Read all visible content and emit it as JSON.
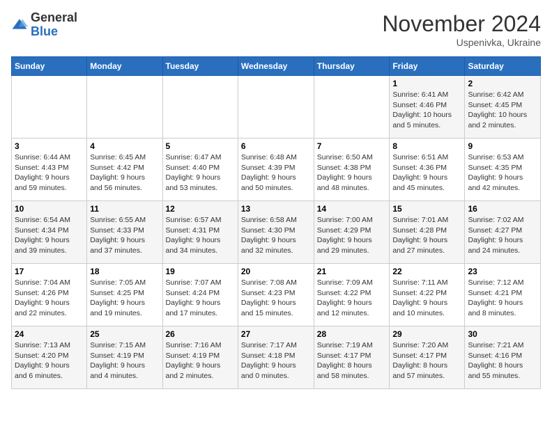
{
  "logo": {
    "general": "General",
    "blue": "Blue"
  },
  "title": "November 2024",
  "subtitle": "Uspenivka, Ukraine",
  "weekdays": [
    "Sunday",
    "Monday",
    "Tuesday",
    "Wednesday",
    "Thursday",
    "Friday",
    "Saturday"
  ],
  "weeks": [
    [
      {
        "day": "",
        "info": ""
      },
      {
        "day": "",
        "info": ""
      },
      {
        "day": "",
        "info": ""
      },
      {
        "day": "",
        "info": ""
      },
      {
        "day": "",
        "info": ""
      },
      {
        "day": "1",
        "info": "Sunrise: 6:41 AM\nSunset: 4:46 PM\nDaylight: 10 hours\nand 5 minutes."
      },
      {
        "day": "2",
        "info": "Sunrise: 6:42 AM\nSunset: 4:45 PM\nDaylight: 10 hours\nand 2 minutes."
      }
    ],
    [
      {
        "day": "3",
        "info": "Sunrise: 6:44 AM\nSunset: 4:43 PM\nDaylight: 9 hours\nand 59 minutes."
      },
      {
        "day": "4",
        "info": "Sunrise: 6:45 AM\nSunset: 4:42 PM\nDaylight: 9 hours\nand 56 minutes."
      },
      {
        "day": "5",
        "info": "Sunrise: 6:47 AM\nSunset: 4:40 PM\nDaylight: 9 hours\nand 53 minutes."
      },
      {
        "day": "6",
        "info": "Sunrise: 6:48 AM\nSunset: 4:39 PM\nDaylight: 9 hours\nand 50 minutes."
      },
      {
        "day": "7",
        "info": "Sunrise: 6:50 AM\nSunset: 4:38 PM\nDaylight: 9 hours\nand 48 minutes."
      },
      {
        "day": "8",
        "info": "Sunrise: 6:51 AM\nSunset: 4:36 PM\nDaylight: 9 hours\nand 45 minutes."
      },
      {
        "day": "9",
        "info": "Sunrise: 6:53 AM\nSunset: 4:35 PM\nDaylight: 9 hours\nand 42 minutes."
      }
    ],
    [
      {
        "day": "10",
        "info": "Sunrise: 6:54 AM\nSunset: 4:34 PM\nDaylight: 9 hours\nand 39 minutes."
      },
      {
        "day": "11",
        "info": "Sunrise: 6:55 AM\nSunset: 4:33 PM\nDaylight: 9 hours\nand 37 minutes."
      },
      {
        "day": "12",
        "info": "Sunrise: 6:57 AM\nSunset: 4:31 PM\nDaylight: 9 hours\nand 34 minutes."
      },
      {
        "day": "13",
        "info": "Sunrise: 6:58 AM\nSunset: 4:30 PM\nDaylight: 9 hours\nand 32 minutes."
      },
      {
        "day": "14",
        "info": "Sunrise: 7:00 AM\nSunset: 4:29 PM\nDaylight: 9 hours\nand 29 minutes."
      },
      {
        "day": "15",
        "info": "Sunrise: 7:01 AM\nSunset: 4:28 PM\nDaylight: 9 hours\nand 27 minutes."
      },
      {
        "day": "16",
        "info": "Sunrise: 7:02 AM\nSunset: 4:27 PM\nDaylight: 9 hours\nand 24 minutes."
      }
    ],
    [
      {
        "day": "17",
        "info": "Sunrise: 7:04 AM\nSunset: 4:26 PM\nDaylight: 9 hours\nand 22 minutes."
      },
      {
        "day": "18",
        "info": "Sunrise: 7:05 AM\nSunset: 4:25 PM\nDaylight: 9 hours\nand 19 minutes."
      },
      {
        "day": "19",
        "info": "Sunrise: 7:07 AM\nSunset: 4:24 PM\nDaylight: 9 hours\nand 17 minutes."
      },
      {
        "day": "20",
        "info": "Sunrise: 7:08 AM\nSunset: 4:23 PM\nDaylight: 9 hours\nand 15 minutes."
      },
      {
        "day": "21",
        "info": "Sunrise: 7:09 AM\nSunset: 4:22 PM\nDaylight: 9 hours\nand 12 minutes."
      },
      {
        "day": "22",
        "info": "Sunrise: 7:11 AM\nSunset: 4:22 PM\nDaylight: 9 hours\nand 10 minutes."
      },
      {
        "day": "23",
        "info": "Sunrise: 7:12 AM\nSunset: 4:21 PM\nDaylight: 9 hours\nand 8 minutes."
      }
    ],
    [
      {
        "day": "24",
        "info": "Sunrise: 7:13 AM\nSunset: 4:20 PM\nDaylight: 9 hours\nand 6 minutes."
      },
      {
        "day": "25",
        "info": "Sunrise: 7:15 AM\nSunset: 4:19 PM\nDaylight: 9 hours\nand 4 minutes."
      },
      {
        "day": "26",
        "info": "Sunrise: 7:16 AM\nSunset: 4:19 PM\nDaylight: 9 hours\nand 2 minutes."
      },
      {
        "day": "27",
        "info": "Sunrise: 7:17 AM\nSunset: 4:18 PM\nDaylight: 9 hours\nand 0 minutes."
      },
      {
        "day": "28",
        "info": "Sunrise: 7:19 AM\nSunset: 4:17 PM\nDaylight: 8 hours\nand 58 minutes."
      },
      {
        "day": "29",
        "info": "Sunrise: 7:20 AM\nSunset: 4:17 PM\nDaylight: 8 hours\nand 57 minutes."
      },
      {
        "day": "30",
        "info": "Sunrise: 7:21 AM\nSunset: 4:16 PM\nDaylight: 8 hours\nand 55 minutes."
      }
    ]
  ]
}
